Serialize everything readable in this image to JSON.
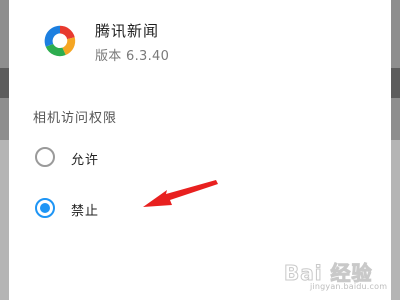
{
  "app": {
    "name": "腾讯新闻",
    "version": "版本 6.3.40",
    "icon": "tencent-news-logo"
  },
  "permission": {
    "title": "相机访问权限",
    "options": [
      {
        "label": "允许",
        "selected": false
      },
      {
        "label": "禁止",
        "selected": true
      }
    ]
  },
  "annotation": {
    "arrow_color": "#e8201f",
    "points_to": "禁止"
  },
  "watermark": {
    "text": "Bai 经验",
    "url": "jingyan.baidu.com"
  },
  "colors": {
    "accent": "#1e95f5",
    "unselected_radio": "#9a9a9a"
  }
}
